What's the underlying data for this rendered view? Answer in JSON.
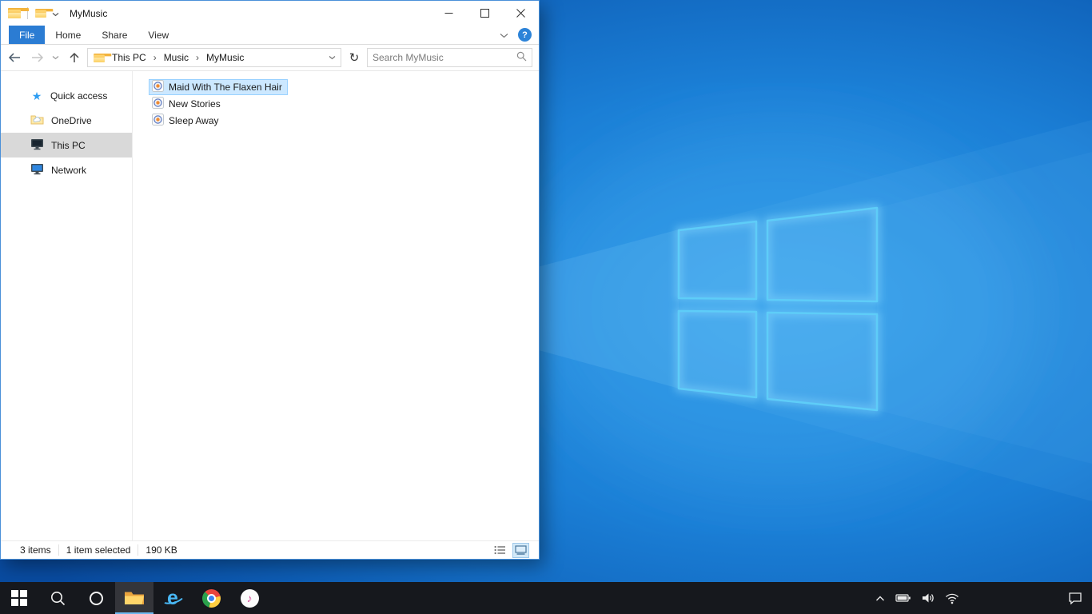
{
  "colors": {
    "accent_blue": "#0078d7",
    "file_tab_blue": "#2b7cd3",
    "selection_bg": "#cce8ff",
    "selection_border": "#99d1ff",
    "sidebar_selected_bg": "#d9d9d9",
    "taskbar_bg": "#16181d",
    "wallpaper_base": "#0a4da0",
    "wallpaper_bright": "#2f9ce8",
    "logo_stroke": "#5ecdf8"
  },
  "window": {
    "title": "MyMusic",
    "ribbon": {
      "tabs": [
        {
          "label": "File",
          "active": true
        },
        {
          "label": "Home",
          "active": false
        },
        {
          "label": "Share",
          "active": false
        },
        {
          "label": "View",
          "active": false
        }
      ],
      "help_label": "?"
    },
    "navbar": {
      "breadcrumb": [
        "This PC",
        "Music",
        "MyMusic"
      ],
      "breadcrumb_separator": "›",
      "search_placeholder": "Search MyMusic"
    },
    "sidebar": {
      "items": [
        {
          "label": "Quick access",
          "icon": "quick-access-star",
          "selected": false
        },
        {
          "label": "OneDrive",
          "icon": "onedrive-folder-cloud",
          "selected": false
        },
        {
          "label": "This PC",
          "icon": "computer-monitor",
          "selected": true
        },
        {
          "label": "Network",
          "icon": "network-monitor",
          "selected": false
        }
      ]
    },
    "files": [
      {
        "name": "Maid With The Flaxen Hair",
        "icon": "media-file",
        "selected": true
      },
      {
        "name": "New Stories",
        "icon": "media-file",
        "selected": false
      },
      {
        "name": "Sleep Away",
        "icon": "media-file",
        "selected": false
      }
    ],
    "statusbar": {
      "count": "3 items",
      "selection": "1 item selected",
      "size": "190 KB"
    }
  },
  "glyphs": {
    "star": "★",
    "refresh": "↻",
    "ie_letter": "e",
    "itunes_note": "♪"
  },
  "taskbar": {
    "buttons": [
      "start",
      "search",
      "cortana",
      "file-explorer",
      "internet-explorer",
      "chrome",
      "itunes"
    ],
    "active_button": "file-explorer",
    "tray": [
      "hidden-icons-chevron",
      "battery",
      "volume",
      "network-wifi",
      "action-center"
    ]
  }
}
